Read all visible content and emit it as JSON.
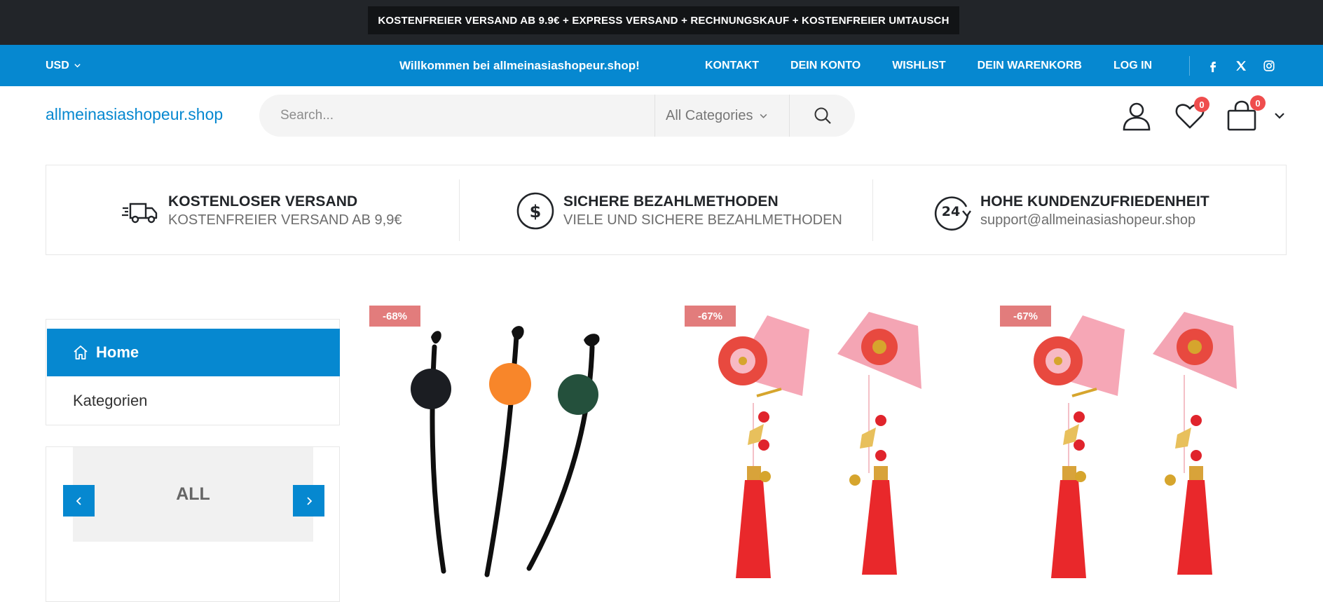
{
  "promo": {
    "text": "KOSTENFREIER VERSAND AB 9.9€ + EXPRESS VERSAND + RECHNUNGSKAUF + KOSTENFREIER UMTAUSCH"
  },
  "topnav": {
    "currency": "USD",
    "welcome": "Willkommen bei allmeinasiashopeur.shop!",
    "links": [
      "KONTAKT",
      "DEIN KONTO",
      "WISHLIST",
      "DEIN WARENKORB",
      "LOG IN"
    ],
    "social_icons": [
      "facebook-icon",
      "x-icon",
      "instagram-icon"
    ]
  },
  "header": {
    "logo": "allmeinasiashopeur.shop",
    "search_placeholder": "Search...",
    "category_select": "All Categories",
    "wishlist_count": "0",
    "cart_count": "0"
  },
  "info": [
    {
      "icon": "truck-icon",
      "title": "KOSTENLOSER VERSAND",
      "sub": "KOSTENFREIER VERSAND AB 9,9€"
    },
    {
      "icon": "dollar-icon",
      "title": "SICHERE BEZAHLMETHODEN",
      "sub": "VIELE UND SICHERE BEZAHLMETHODEN"
    },
    {
      "icon": "24h-icon",
      "title": "HOHE KUNDENZUFRIEDENHEIT",
      "sub": "support@allmeinasiashopeur.shop"
    }
  ],
  "sidebar": {
    "home": "Home",
    "categories": "Kategorien",
    "filter_label": "ALL"
  },
  "products": [
    {
      "discount": "-68%"
    },
    {
      "discount": "-67%"
    },
    {
      "discount": "-67%"
    }
  ],
  "colors": {
    "brand_blue": "#0688d0",
    "dark": "#222529",
    "badge_red": "#ef4d4d",
    "sale_badge": "#e27c7c"
  }
}
